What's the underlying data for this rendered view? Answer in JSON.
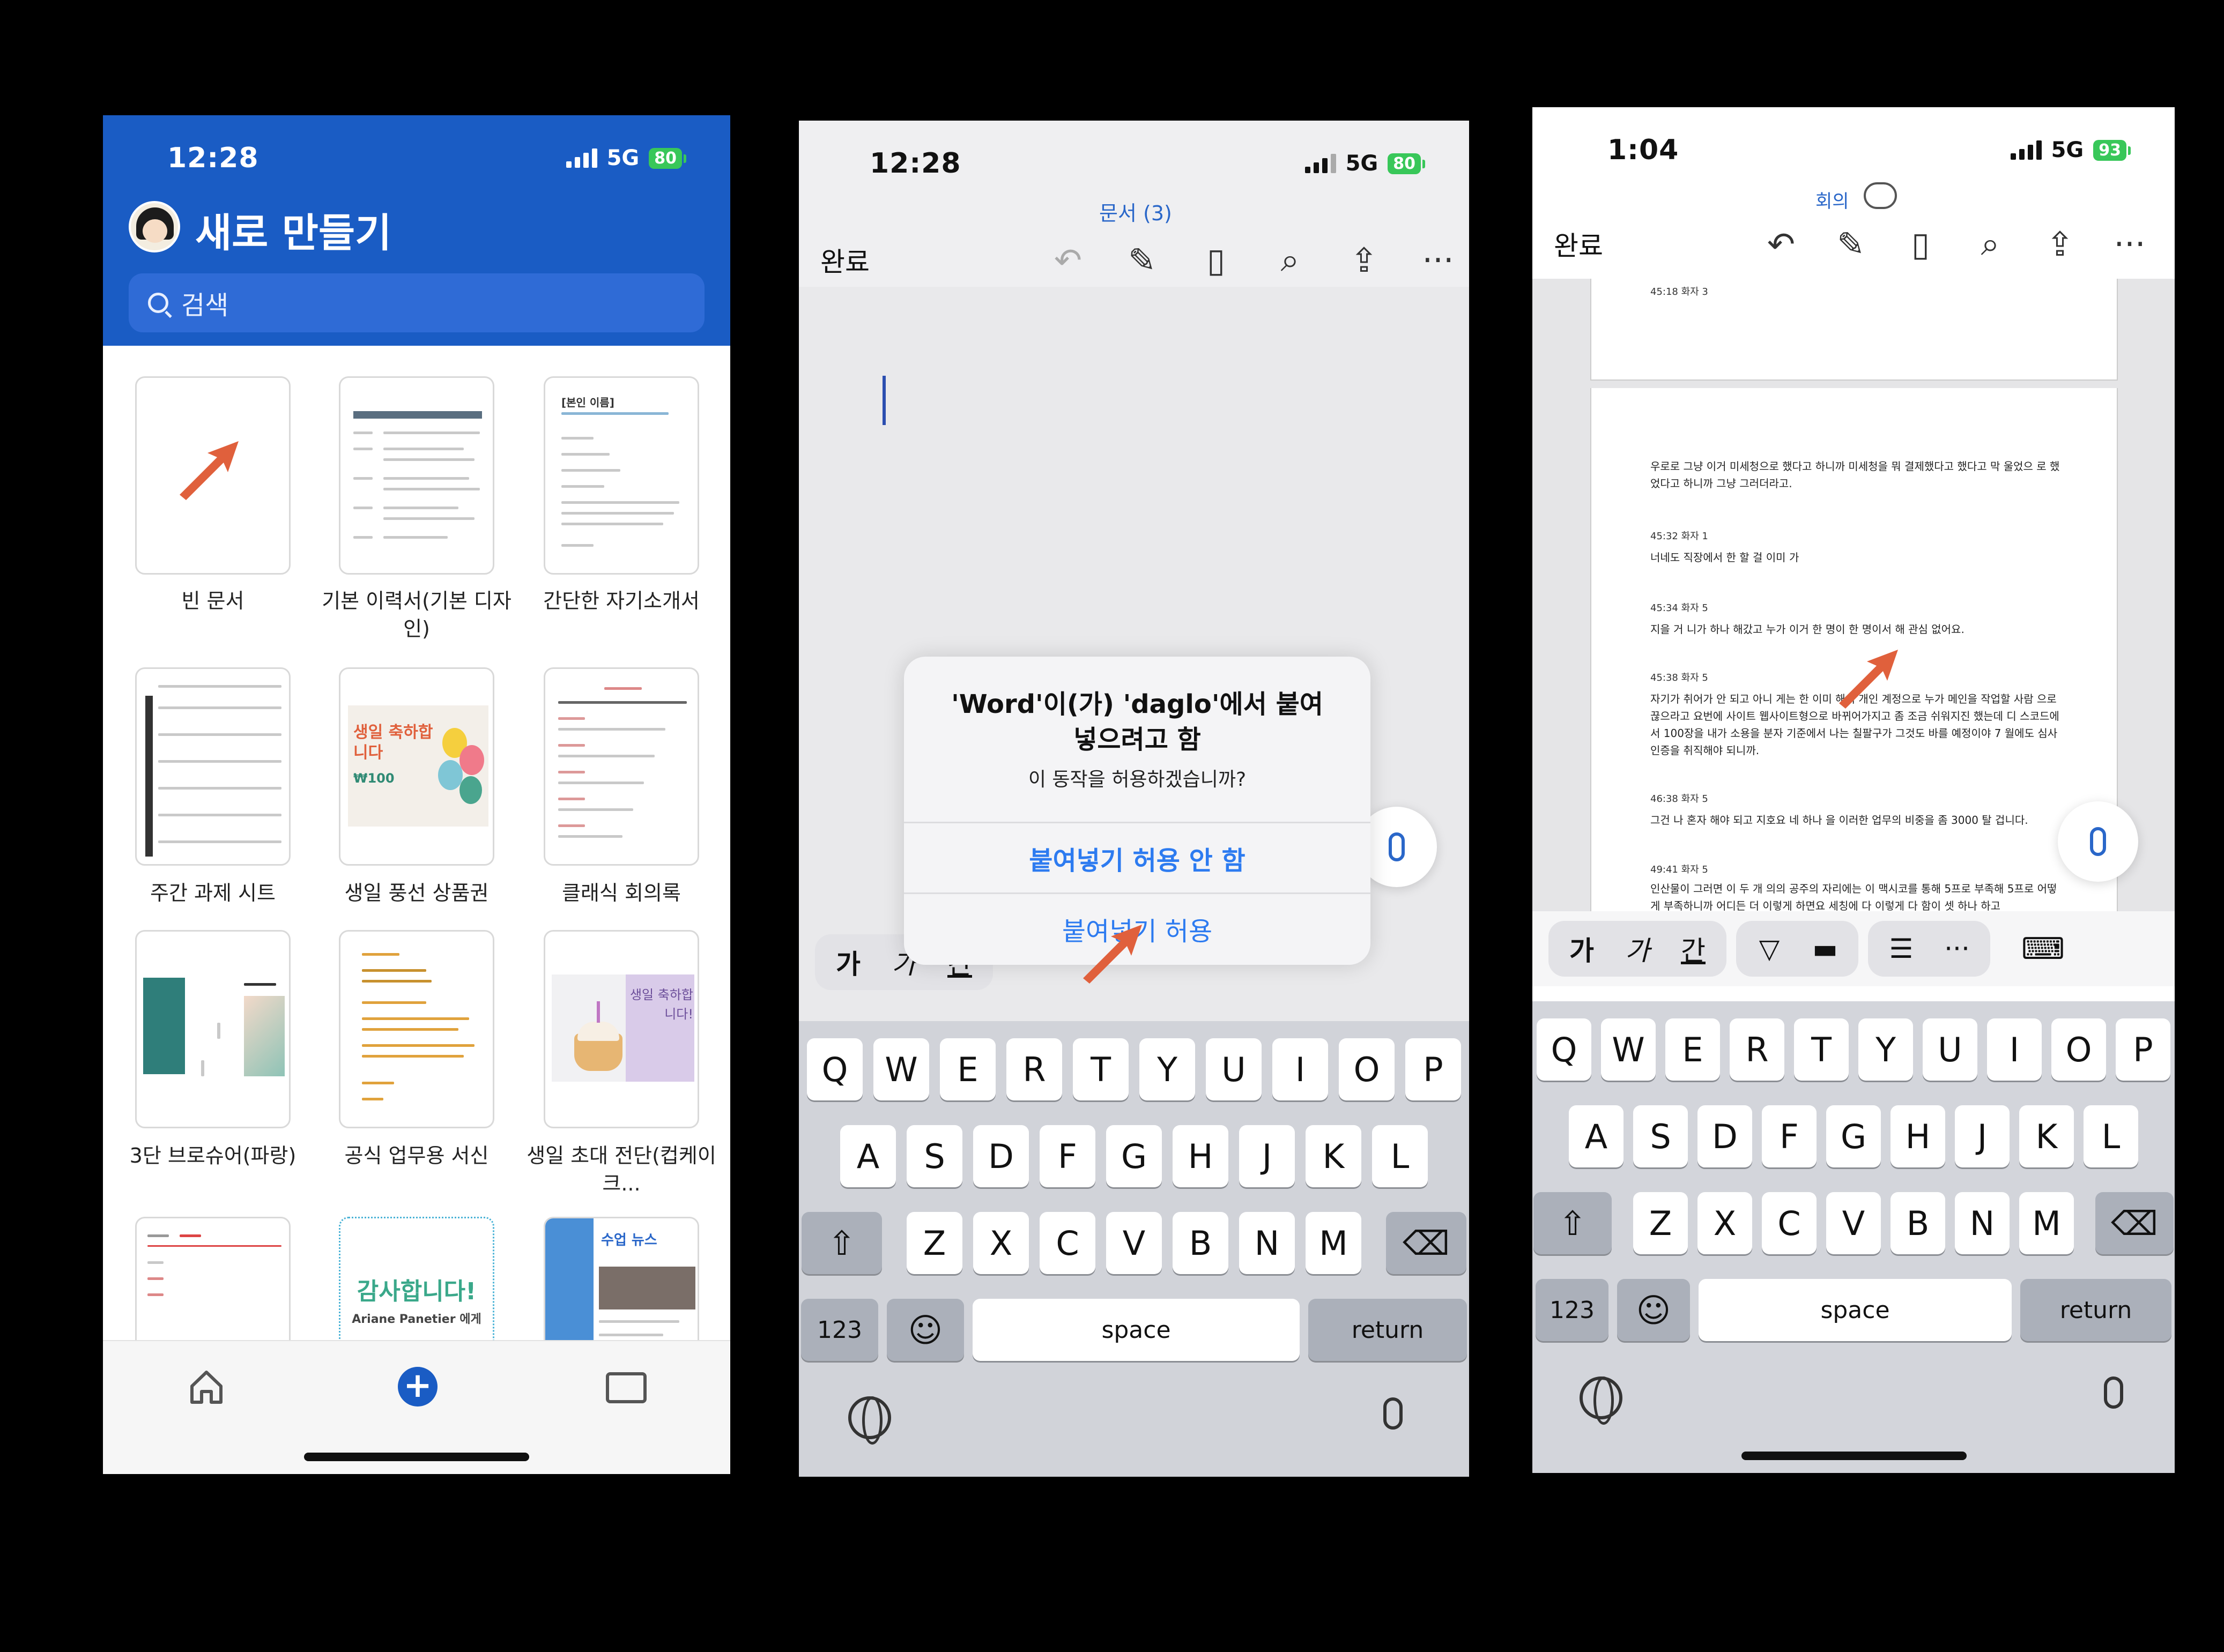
{
  "colors": {
    "brand_blue": "#1a5cc4",
    "accent_arrow": "#e0603c",
    "ios_link": "#2d7bf0",
    "battery_green": "#38c759"
  },
  "phone1": {
    "status": {
      "time": "12:28",
      "network": "5G",
      "battery": "80"
    },
    "title": "새로 만들기",
    "search_placeholder": "검색",
    "templates": [
      {
        "label": "빈 문서"
      },
      {
        "label": "기본 이력서(기본 디자인)"
      },
      {
        "label": "간단한 자기소개서",
        "thumb_text": "[본인 이름]"
      },
      {
        "label": "주간 과제 시트"
      },
      {
        "label": "생일 풍선 상품권",
        "thumb_text": "생일 축하합니다",
        "thumb_price": "₩100"
      },
      {
        "label": "클래식 회의록"
      },
      {
        "label": "3단 브로슈어(파랑)"
      },
      {
        "label": "공식 업무용 서신"
      },
      {
        "label": "생일 초대 전단(컵케이크...",
        "thumb_text": "생일 축하합니다!"
      },
      {
        "label": ""
      },
      {
        "label": "",
        "thumb_text": "감사합니다!",
        "thumb_sub": "Ariane Panetier 에게"
      },
      {
        "label": "",
        "thumb_text": "수업 뉴스"
      }
    ],
    "tabs": [
      "home-icon",
      "add-icon",
      "folder-icon"
    ]
  },
  "phone2": {
    "status": {
      "time": "12:28",
      "network": "5G",
      "battery": "80"
    },
    "doc_name": "문서 (3)",
    "done_label": "완료",
    "alert": {
      "title": "'Word'이(가) 'daglo'에서 붙여넣으려고 함",
      "message": "이 동작을 허용하겠습니까?",
      "deny": "붙여넣기 허용 안 함",
      "allow": "붙여넣기 허용"
    }
  },
  "phone3": {
    "status": {
      "time": "1:04",
      "network": "5G",
      "battery": "93"
    },
    "doc_name": "회의",
    "done_label": "완료",
    "top_speaker": "45:18 화자 3",
    "blocks": [
      {
        "speaker": "",
        "text": "우로로 그냥 이거 미세청으로 했다고 하니까 미세청을 뭐 결제했다고 했다고 막 울었으 로 했었다고 하니까 그냥 그러더라고."
      },
      {
        "speaker": "45:32 화자 1",
        "text": "너네도 직장에서 한 할 걸 이미 가"
      },
      {
        "speaker": "45:34 화자 5",
        "text": "지을 거 니가 하나 해갔고 누가 이거 한 명이 한 명이서 해 관심 없어요."
      },
      {
        "speaker": "45:38 화자 5",
        "text": "자기가 취어가 안 되고 아니 게는 한 이미 해서 개인 계정으로 누가 메인을 작업할 사람 으로 끊으라고 요번에 사이트 웹사이트형으로 바뀌어가지고 좀 조금 쉬워지진 했는데 디 스코드에서 100장을 내가 소용을 분자 기준에서 나는 칠팔구가 그것도 바를 예정이야 7 월에도 심사 인증을 취직해야 되니까."
      },
      {
        "speaker": "46:38 화자 5",
        "text": "그건 나 혼자 해야 되고 지호요 네 하나 을 이러한 업무의 비중을 좀 3000 탈 겁니다."
      },
      {
        "speaker": "49:41 화자 5",
        "text": "인산물이 그러면 이 두 개 의의 공주의 자리에는 이 맥시코를 통해 5프로 부족해 5프로 어떻게 부족하니까 어디든 더 이렇게 하면요 세칭에 다 이렇게 다 함이 셋 하나 하고"
      }
    ]
  },
  "format_bar": {
    "buttons": [
      "가",
      "가",
      "간",
      "",
      "",
      "",
      "···",
      ""
    ]
  },
  "keyboard": {
    "row1": [
      "Q",
      "W",
      "E",
      "R",
      "T",
      "Y",
      "U",
      "I",
      "O",
      "P"
    ],
    "row2": [
      "A",
      "S",
      "D",
      "F",
      "G",
      "H",
      "J",
      "K",
      "L"
    ],
    "row3": [
      "Z",
      "X",
      "C",
      "V",
      "B",
      "N",
      "M"
    ],
    "numbers": "123",
    "space": "space",
    "return": "return"
  }
}
